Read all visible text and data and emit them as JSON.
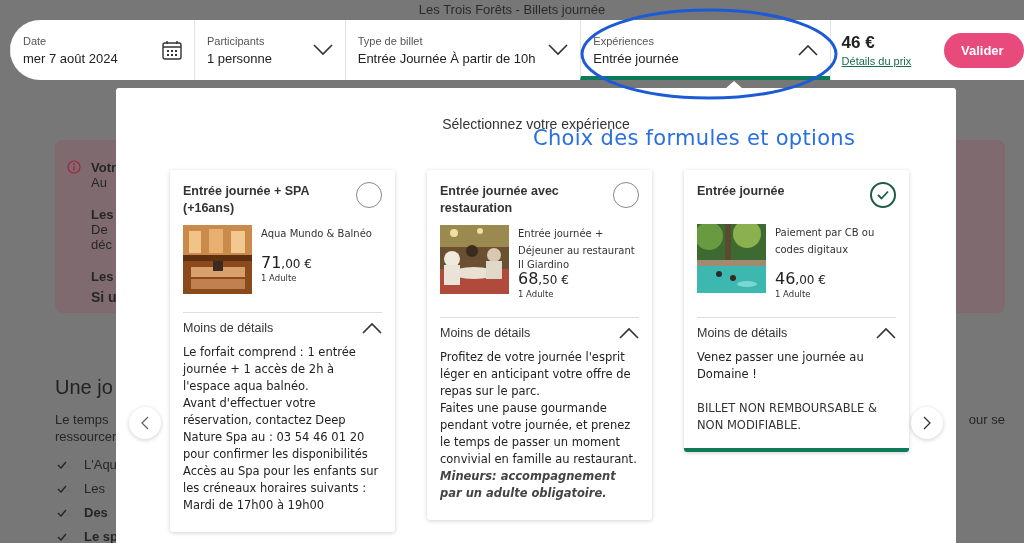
{
  "page_title": "Les Trois Forêts - Billets journée",
  "booking_bar": {
    "fields": [
      {
        "label": "Date",
        "value": "mer 7 août 2024",
        "kind": "date",
        "selected": false
      },
      {
        "label": "Participants",
        "value": "1 personne",
        "kind": "dropdown",
        "expanded": false,
        "selected": false
      },
      {
        "label": "Type de billet",
        "value": "Entrée Journée À partir de 10h",
        "kind": "dropdown",
        "expanded": false,
        "selected": false
      },
      {
        "label": "Expériences",
        "value": "Entrée journée",
        "kind": "dropdown",
        "expanded": true,
        "selected": true
      }
    ],
    "price": "46 €",
    "price_link": "Détails du prix",
    "submit": "Valider"
  },
  "background": {
    "notice_lines": [
      {
        "text": "Votr",
        "bold": true,
        "kind": "first"
      },
      {
        "text": "Au",
        "bold": false,
        "kind": "line"
      },
      {
        "text": "Les",
        "bold": true,
        "kind": "block"
      },
      {
        "text": "De",
        "bold": false,
        "kind": "line"
      },
      {
        "text": "déc",
        "bold": false,
        "kind": "line"
      },
      {
        "text": "Les",
        "bold": true,
        "kind": "block"
      },
      {
        "text": "Si u",
        "bold": true,
        "kind": "line"
      }
    ],
    "heading": "Une jo",
    "paragraph_lines": [
      "Le temps",
      "ressourcer"
    ],
    "paragraph_tail": "our se",
    "list_items": [
      {
        "text": "L'Aqu",
        "bold": false
      },
      {
        "text": "Les",
        "bold": false
      },
      {
        "text": "Des",
        "bold": true
      },
      {
        "text": "Le sp",
        "bold": true
      }
    ]
  },
  "annotation": {
    "text": "Choix des formules et options"
  },
  "modal": {
    "title": "Sélectionnez votre expérience",
    "cards": [
      {
        "title": "Entrée journée + SPA (+16ans)",
        "selected": false,
        "description": "Aqua Mundo & Balnéo",
        "price": "71",
        "price_decimals": ",00 €",
        "price_note": "1 Adulte",
        "details_toggle": "Moins de détails",
        "expanded": true,
        "details": [
          {
            "text": "Le forfait comprend : 1 entrée journée + 1 accès de 2h à l'espace aqua balnéo.",
            "kind": "text"
          },
          {
            "text": "Avant d'effectuer votre réservation, contactez Deep Nature Spa au : 03 54 46 01 20 pour confirmer les disponibilités",
            "kind": "text"
          },
          {
            "text": "Accès au Spa pour les enfants sur les créneaux horaires suivants :",
            "kind": "text"
          },
          {
            "text": "Mardi de 17h00 à 19h00",
            "kind": "text"
          }
        ]
      },
      {
        "title": "Entrée journée avec restauration",
        "selected": false,
        "description": "Entrée journée + Déjeuner au restaurant",
        "subtitle": "Il Giardino",
        "price": "68",
        "price_decimals": ",50 €",
        "price_note": "1 Adulte",
        "details_toggle": "Moins de détails",
        "expanded": true,
        "details": [
          {
            "text": "Profitez de votre journée l'esprit léger en anticipant votre offre de repas sur le parc.",
            "kind": "text"
          },
          {
            "text": "Faites une pause gourmande pendant votre journée, et prenez le temps de passer un moment convivial en famille au restaurant.",
            "kind": "text"
          },
          {
            "text": "Mineurs: accompagnement par un adulte obligatoire.",
            "kind": "note"
          }
        ]
      },
      {
        "title": "Entrée journée",
        "selected": true,
        "description": "Paiement par CB ou codes digitaux",
        "price": "46",
        "price_decimals": ",00 €",
        "price_note": "1 Adulte",
        "details_toggle": "Moins de détails",
        "expanded": true,
        "details": [
          {
            "text": "Venez passer une journée au Domaine !",
            "kind": "text"
          },
          {
            "text": "BILLET NON REMBOURSABLE & NON MODIFIABLE.",
            "kind": "notice"
          }
        ]
      }
    ]
  }
}
